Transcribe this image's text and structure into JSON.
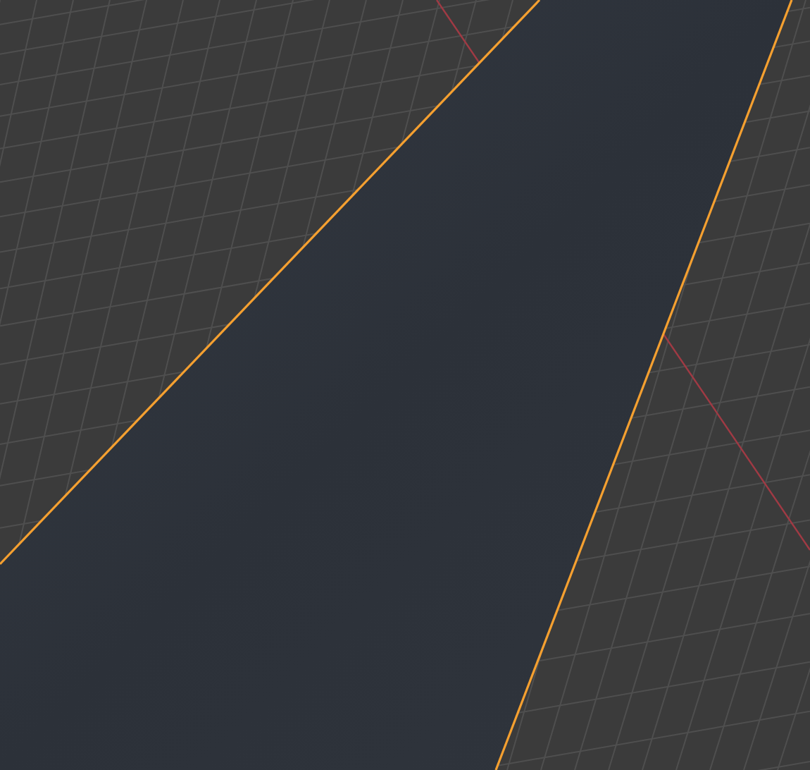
{
  "viewport": {
    "plane": {
      "selected": true
    }
  }
}
